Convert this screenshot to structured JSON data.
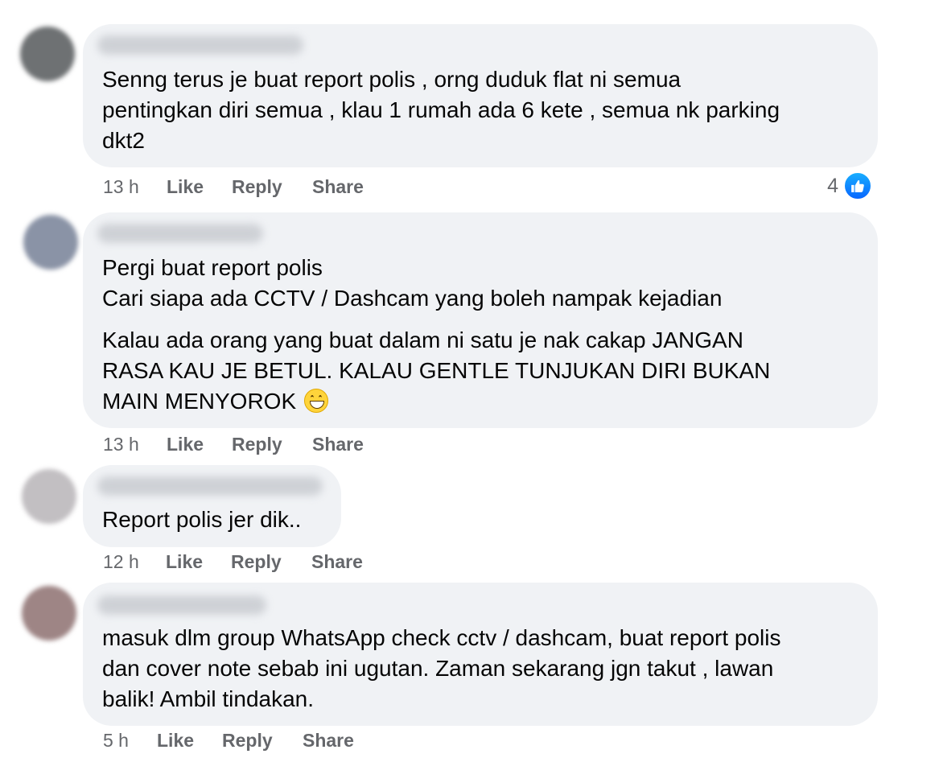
{
  "comments": [
    {
      "text": "Senng terus je buat report polis , orng duduk flat ni semua\npentingkan diri semua , klau 1 rumah ada 6 kete , semua nk parking\ndkt2",
      "time": "13 h",
      "like": "Like",
      "reply": "Reply",
      "share": "Share",
      "reaction_count": "4",
      "avatar_color": "#6e7173"
    },
    {
      "text_a": "Pergi buat report polis\nCari siapa ada CCTV / Dashcam yang boleh nampak kejadian",
      "text_b": "Kalau ada orang yang buat dalam ni satu je nak cakap JANGAN\nRASA KAU JE BETUL. KALAU GENTLE TUNJUKAN DIRI BUKAN\nMAIN MENYOROK",
      "emoji": "grinning-face-with-smiling-eyes",
      "time": "13 h",
      "like": "Like",
      "reply": "Reply",
      "share": "Share",
      "avatar_color": "#8a93a6"
    },
    {
      "text": "Report polis jer dik..",
      "time": "12 h",
      "like": "Like",
      "reply": "Reply",
      "share": "Share",
      "avatar_color": "#c2bfc2"
    },
    {
      "text": "masuk dlm group WhatsApp check cctv / dashcam, buat report polis\ndan cover note sebab ini ugutan. Zaman sekarang jgn takut , lawan\nbalik! Ambil tindakan.",
      "time": "5 h",
      "like": "Like",
      "reply": "Reply",
      "share": "Share",
      "avatar_color": "#9e8585"
    }
  ],
  "colors": {
    "bubble": "#f0f2f5",
    "meta_text": "#65676b",
    "like_blue": "#0866ff"
  }
}
